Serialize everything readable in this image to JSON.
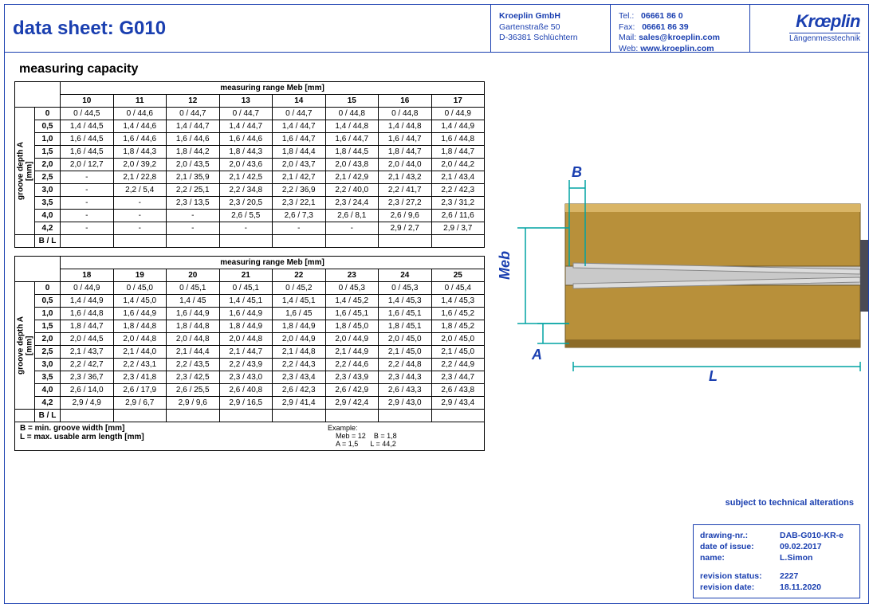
{
  "header": {
    "title": "data sheet:  G010",
    "company": "Kroeplin GmbH",
    "street": "Gartenstraße 50",
    "city": "D-36381 Schlüchtern",
    "tel_lbl": "Tel.:",
    "tel": "06661 86 0",
    "fax_lbl": "Fax:",
    "fax": "06661 86 39",
    "mail_lbl": "Mail:",
    "mail": "sales@kroeplin.com",
    "web_lbl": "Web:",
    "web": "www.kroeplin.com",
    "logo": "Krœplin",
    "logo_sub": "Längenmesstechnik"
  },
  "section_title": "measuring capacity",
  "table_caption": "measuring range Meb [mm]",
  "vhead": "groove depth A\n[mm]",
  "bl_label": "B / L",
  "table1": {
    "cols": [
      "10",
      "11",
      "12",
      "13",
      "14",
      "15",
      "16",
      "17"
    ],
    "rows": [
      {
        "h": "0",
        "c": [
          "0 / 44,5",
          "0 / 44,6",
          "0 / 44,7",
          "0 / 44,7",
          "0 / 44,7",
          "0 / 44,8",
          "0 / 44,8",
          "0 / 44,9"
        ]
      },
      {
        "h": "0,5",
        "c": [
          "1,4 / 44,5",
          "1,4 / 44,6",
          "1,4 / 44,7",
          "1,4 / 44,7",
          "1,4 / 44,7",
          "1,4 / 44,8",
          "1,4 / 44,8",
          "1,4 / 44,9"
        ]
      },
      {
        "h": "1,0",
        "c": [
          "1,6 / 44,5",
          "1,6 / 44,6",
          "1,6 / 44,6",
          "1,6 / 44,6",
          "1,6 / 44,7",
          "1,6 / 44,7",
          "1,6 / 44,7",
          "1,6 / 44,8"
        ]
      },
      {
        "h": "1,5",
        "c": [
          "1,6 / 44,5",
          "1,8 / 44,3",
          "1,8 / 44,2",
          "1,8 / 44,3",
          "1,8 / 44,4",
          "1,8 / 44,5",
          "1,8 / 44,7",
          "1,8 / 44,7"
        ]
      },
      {
        "h": "2,0",
        "c": [
          "2,0 / 12,7",
          "2,0 / 39,2",
          "2,0 / 43,5",
          "2,0 / 43,6",
          "2,0 / 43,7",
          "2,0 / 43,8",
          "2,0 / 44,0",
          "2,0 / 44,2"
        ]
      },
      {
        "h": "2,5",
        "c": [
          "-",
          "2,1 / 22,8",
          "2,1 / 35,9",
          "2,1 / 42,5",
          "2,1 / 42,7",
          "2,1 / 42,9",
          "2,1 / 43,2",
          "2,1 / 43,4"
        ]
      },
      {
        "h": "3,0",
        "c": [
          "-",
          "2,2 / 5,4",
          "2,2 / 25,1",
          "2,2 / 34,8",
          "2,2 / 36,9",
          "2,2 / 40,0",
          "2,2 / 41,7",
          "2,2 / 42,3"
        ]
      },
      {
        "h": "3,5",
        "c": [
          "-",
          "-",
          "2,3 / 13,5",
          "2,3 / 20,5",
          "2,3 / 22,1",
          "2,3 / 24,4",
          "2,3 / 27,2",
          "2,3 / 31,2"
        ]
      },
      {
        "h": "4,0",
        "c": [
          "-",
          "-",
          "-",
          "2,6 / 5,5",
          "2,6 / 7,3",
          "2,6 / 8,1",
          "2,6 / 9,6",
          "2,6 / 11,6"
        ]
      },
      {
        "h": "4,2",
        "c": [
          "-",
          "-",
          "-",
          "-",
          "-",
          "-",
          "2,9 / 2,7",
          "2,9 / 3,7"
        ]
      }
    ]
  },
  "table2": {
    "cols": [
      "18",
      "19",
      "20",
      "21",
      "22",
      "23",
      "24",
      "25"
    ],
    "rows": [
      {
        "h": "0",
        "c": [
          "0 / 44,9",
          "0 / 45,0",
          "0 / 45,1",
          "0 / 45,1",
          "0 / 45,2",
          "0 / 45,3",
          "0 / 45,3",
          "0 / 45,4"
        ]
      },
      {
        "h": "0,5",
        "c": [
          "1,4 / 44,9",
          "1,4 / 45,0",
          "1,4 / 45",
          "1,4 / 45,1",
          "1,4 / 45,1",
          "1,4 / 45,2",
          "1,4 / 45,3",
          "1,4 / 45,3"
        ]
      },
      {
        "h": "1,0",
        "c": [
          "1,6 / 44,8",
          "1,6 / 44,9",
          "1,6 / 44,9",
          "1,6 / 44,9",
          "1,6 / 45",
          "1,6 / 45,1",
          "1,6 / 45,1",
          "1,6 / 45,2"
        ]
      },
      {
        "h": "1,5",
        "c": [
          "1,8 / 44,7",
          "1,8 / 44,8",
          "1,8 / 44,8",
          "1,8 / 44,9",
          "1,8 / 44,9",
          "1,8 / 45,0",
          "1,8 / 45,1",
          "1,8 / 45,2"
        ]
      },
      {
        "h": "2,0",
        "c": [
          "2,0 / 44,5",
          "2,0 / 44,8",
          "2,0 / 44,8",
          "2,0 / 44,8",
          "2,0 / 44,9",
          "2,0 / 44,9",
          "2,0 / 45,0",
          "2,0 / 45,0"
        ]
      },
      {
        "h": "2,5",
        "c": [
          "2,1 / 43,7",
          "2,1 / 44,0",
          "2,1 / 44,4",
          "2,1 / 44,7",
          "2,1 / 44,8",
          "2,1 / 44,9",
          "2,1 / 45,0",
          "2,1 / 45,0"
        ]
      },
      {
        "h": "3,0",
        "c": [
          "2,2 / 42,7",
          "2,2 / 43,1",
          "2,2 / 43,5",
          "2,2 / 43,9",
          "2,2 / 44,3",
          "2,2 / 44,6",
          "2,2 / 44,8",
          "2,2 / 44,9"
        ]
      },
      {
        "h": "3,5",
        "c": [
          "2,3 / 36,7",
          "2,3 / 41,8",
          "2,3 / 42,5",
          "2,3 / 43,0",
          "2,3 / 43,4",
          "2,3 / 43,9",
          "2,3 / 44,3",
          "2,3 / 44,7"
        ]
      },
      {
        "h": "4,0",
        "c": [
          "2,6 / 14,0",
          "2,6 / 17,9",
          "2,6 / 25,5",
          "2,6 / 40,8",
          "2,6 / 42,3",
          "2,6 / 42,9",
          "2,6 / 43,3",
          "2,6 / 43,8"
        ]
      },
      {
        "h": "4,2",
        "c": [
          "2,9 / 4,9",
          "2,9 / 6,7",
          "2,9 / 9,6",
          "2,9 / 16,5",
          "2,9 / 41,4",
          "2,9 / 42,4",
          "2,9 / 43,0",
          "2,9 / 43,4"
        ]
      }
    ]
  },
  "legend": {
    "b": "B = min. groove width [mm]",
    "l": "L = max. usable arm length [mm]",
    "ex_title": "Example:",
    "ex1a": "Meb = 12",
    "ex1b": "B = 1,8",
    "ex2a": "A = 1,5",
    "ex2b": "L = 44,2"
  },
  "diagram_labels": {
    "B": "B",
    "Meb": "Meb",
    "A": "A",
    "L": "L"
  },
  "alter": "subject to technical alterations",
  "drawbox": {
    "l1": "drawing-nr.:",
    "v1": "DAB-G010-KR-e",
    "l2": "date of issue:",
    "v2": "09.02.2017",
    "l3": "name:",
    "v3": "L.Simon",
    "l4": "revision status:",
    "v4": "2227",
    "l5": "revision date:",
    "v5": "18.11.2020"
  }
}
